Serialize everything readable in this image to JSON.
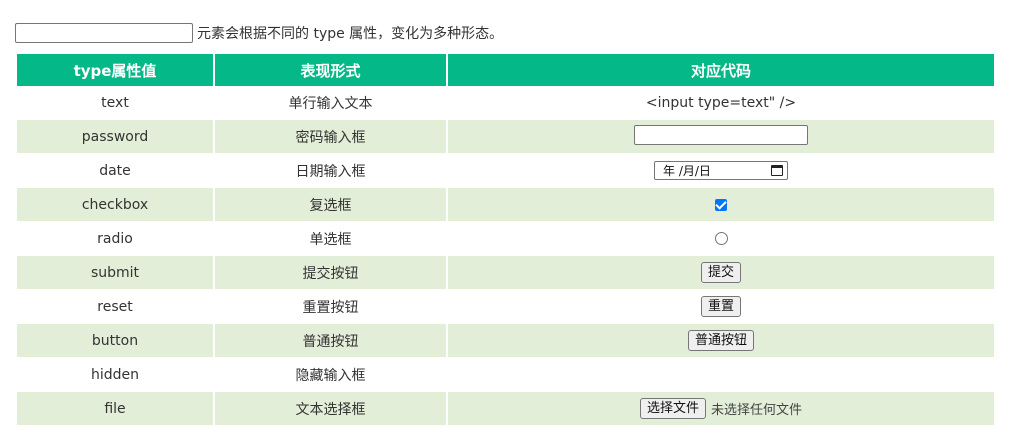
{
  "intro": {
    "input_value": "",
    "text": "元素会根据不同的 type 属性，变化为多种形态。"
  },
  "table": {
    "headers": [
      "type属性值",
      "表现形式",
      "对应代码"
    ],
    "rows": [
      {
        "type": "text",
        "form": "单行输入文本",
        "code": "<input type=text\" />"
      },
      {
        "type": "password",
        "form": "密码输入框",
        "code": ""
      },
      {
        "type": "date",
        "form": "日期输入框",
        "code": "年 /月/日"
      },
      {
        "type": "checkbox",
        "form": "复选框",
        "code": "checked"
      },
      {
        "type": "radio",
        "form": "单选框",
        "code": "unchecked"
      },
      {
        "type": "submit",
        "form": "提交按钮",
        "code": "提交"
      },
      {
        "type": "reset",
        "form": "重置按钮",
        "code": "重置"
      },
      {
        "type": "button",
        "form": "普通按钮",
        "code": "普通按钮"
      },
      {
        "type": "hidden",
        "form": "隐藏输入框",
        "code": ""
      },
      {
        "type": "file",
        "form": "文本选择框",
        "code": "选择文件",
        "status": "未选择任何文件"
      }
    ]
  },
  "colors": {
    "header_bg": "#04b887",
    "alt_row_bg": "#e3eed8",
    "checkbox_accent": "#0075ff"
  }
}
